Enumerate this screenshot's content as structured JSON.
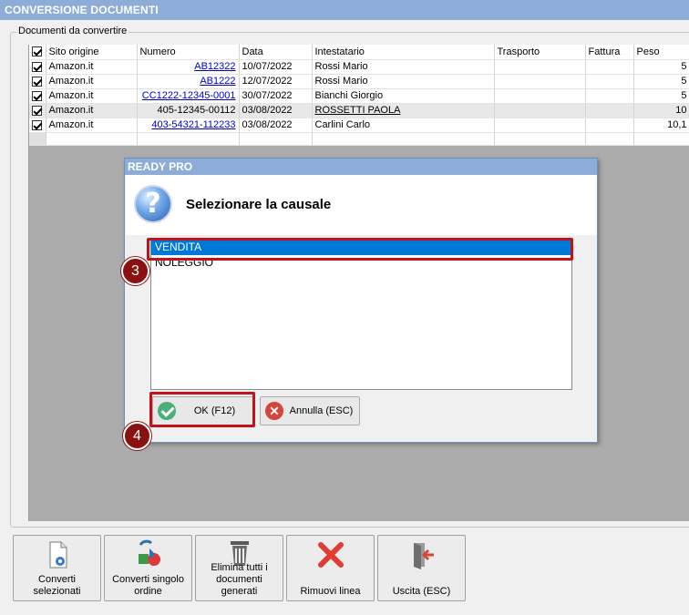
{
  "window": {
    "title": "CONVERSIONE DOCUMENTI"
  },
  "group": {
    "label": "Documenti da convertire"
  },
  "grid": {
    "columns": [
      "Sito origine",
      "Numero",
      "Data",
      "Intestatario",
      "Trasporto",
      "Fattura",
      "Peso"
    ],
    "rows": [
      {
        "checked": true,
        "sito": "Amazon.it",
        "numero": "AB12322",
        "data": "10/07/2022",
        "intestatario": "Rossi Mario",
        "trasporto": "",
        "fattura": "",
        "peso": "5"
      },
      {
        "checked": true,
        "sito": "Amazon.it",
        "numero": "AB1222",
        "data": "12/07/2022",
        "intestatario": "Rossi Mario",
        "trasporto": "",
        "fattura": "",
        "peso": "5"
      },
      {
        "checked": true,
        "sito": "Amazon.it",
        "numero": "CC1222-12345-0001",
        "data": "30/07/2022",
        "intestatario": "Bianchi Giorgio",
        "trasporto": "",
        "fattura": "",
        "peso": "5"
      },
      {
        "checked": true,
        "sito": "Amazon.it",
        "numero": "405-12345-00112",
        "data": "03/08/2022",
        "intestatario": "ROSSETTI PAOLA",
        "trasporto": "",
        "fattura": "",
        "peso": "10"
      },
      {
        "checked": true,
        "sito": "Amazon.it",
        "numero": "403-54321-112233",
        "data": "03/08/2022",
        "intestatario": "Carlini Carlo",
        "trasporto": "",
        "fattura": "",
        "peso": "10,1"
      }
    ]
  },
  "dialog": {
    "title": "READY PRO",
    "question": "Selezionare la causale",
    "options": [
      "VENDITA",
      "NOLEGGIO"
    ],
    "selected_option": "VENDITA",
    "ok_label": "OK (F12)",
    "cancel_label": "Annulla (ESC)",
    "badges": [
      "3",
      "4"
    ],
    "highlight_color": "#c0131b"
  },
  "toolbar": {
    "convert_selected": "Converti selezionati",
    "convert_single": "Converti singolo ordine",
    "delete_all": "Elimina tutti i documenti generati",
    "remove_line": "Rimuovi linea",
    "exit": "Uscita (ESC)"
  },
  "colors": {
    "title_bar": "#8dadd8",
    "selection": "#0078d7",
    "link": "#0000cc"
  }
}
